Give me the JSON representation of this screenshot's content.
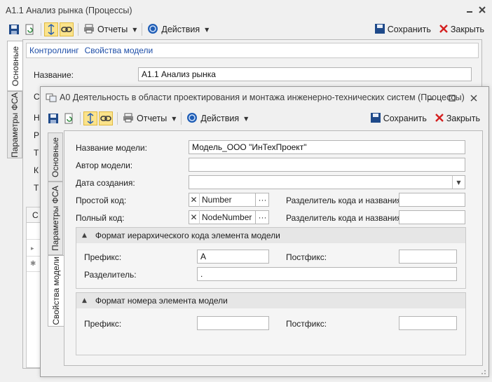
{
  "back_window": {
    "title": "A1.1 Анализ рынка (Процессы)",
    "toolbar": {
      "reports": "Отчеты",
      "actions": "Действия",
      "save": "Сохранить",
      "close": "Закрыть"
    },
    "tabs": [
      "Основные",
      "Параметры ФСА"
    ],
    "links": {
      "controlling": "Контроллинг",
      "model_props": "Свойства модели"
    },
    "name_label": "Название:",
    "name_value": "A1.1 Анализ рынка",
    "hidden_labels": [
      "Н",
      "С",
      "Р",
      "Т",
      "К",
      "Т"
    ],
    "grid_letter": "С",
    "grid_markers": [
      "▸",
      "✱"
    ]
  },
  "front_window": {
    "title": "A0 Деятельность в области проектирования и монтажа инженерно-технических систем (Процессы)",
    "toolbar": {
      "reports": "Отчеты",
      "actions": "Действия",
      "save": "Сохранить",
      "close": "Закрыть"
    },
    "tabs": [
      "Основные",
      "Параметры ФСА",
      "Свойства модели"
    ],
    "form": {
      "model_name_label": "Название модели:",
      "model_name_value": "Модель_ООО \"ИнТехПроект\"",
      "author_label": "Автор модели:",
      "author_value": "",
      "created_label": "Дата создания:",
      "created_value": "",
      "simple_code_label": "Простой код:",
      "simple_code_value": "Number",
      "full_code_label": "Полный код:",
      "full_code_value": "NodeNumber",
      "separator_label_1": "Разделитель кода и названия:",
      "separator_label_2": "Разделитель кода и названия:",
      "separator_value_1": "",
      "separator_value_2": ""
    },
    "group1": {
      "title": "Формат иерархического кода элемента модели",
      "prefix_label": "Префикс:",
      "prefix_value": "A",
      "postfix_label": "Постфикс:",
      "postfix_value": "",
      "sep_label": "Разделитель:",
      "sep_value": "."
    },
    "group2": {
      "title": "Формат номера элемента модели",
      "prefix_label": "Префикс:",
      "prefix_value": "",
      "postfix_label": "Постфикс:",
      "postfix_value": ""
    }
  }
}
